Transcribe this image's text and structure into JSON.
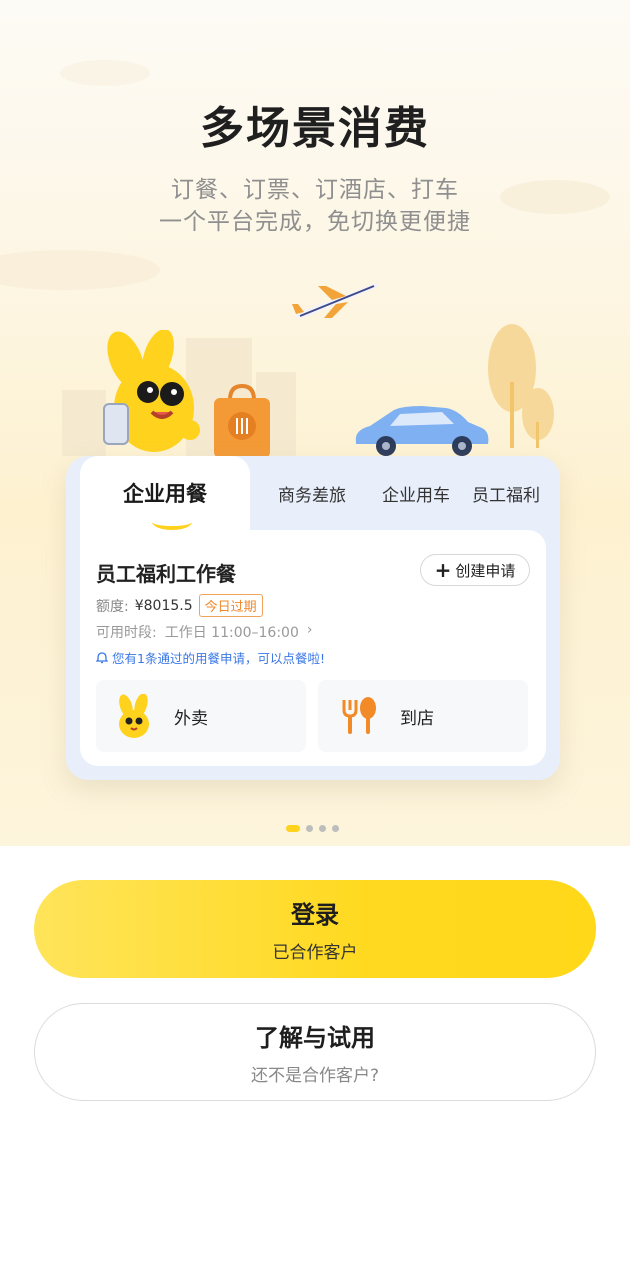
{
  "hero": {
    "title": "多场景消费",
    "subtitle_line1": "订餐、订票、订酒店、打车",
    "subtitle_line2": "一个平台完成，免切换更便捷"
  },
  "card": {
    "tabs": [
      {
        "label": "企业用餐",
        "active": true
      },
      {
        "label": "商务差旅",
        "active": false
      },
      {
        "label": "企业用车",
        "active": false
      },
      {
        "label": "员工福利",
        "active": false
      }
    ],
    "meal_title": "员工福利工作餐",
    "create_button": "创建申请",
    "quota_label": "额度:",
    "quota_value": "¥8015.5",
    "expire_badge": "今日过期",
    "time_label": "可用时段:",
    "time_value": "工作日 11:00–16:00",
    "notice": "您有1条通过的用餐申请，可以点餐啦!",
    "options": [
      {
        "label": "外卖",
        "icon": "bunny-mascot-icon"
      },
      {
        "label": "到店",
        "icon": "fork-spoon-icon"
      }
    ]
  },
  "pagination": {
    "total": 4,
    "current": 1
  },
  "buttons": {
    "login_main": "登录",
    "login_sub": "已合作客户",
    "trial_main": "了解与试用",
    "trial_sub": "还不是合作客户?"
  },
  "colors": {
    "accent_yellow": "#FFD91F",
    "notice_blue": "#3B78E7",
    "badge_orange": "#EF8A2E"
  }
}
